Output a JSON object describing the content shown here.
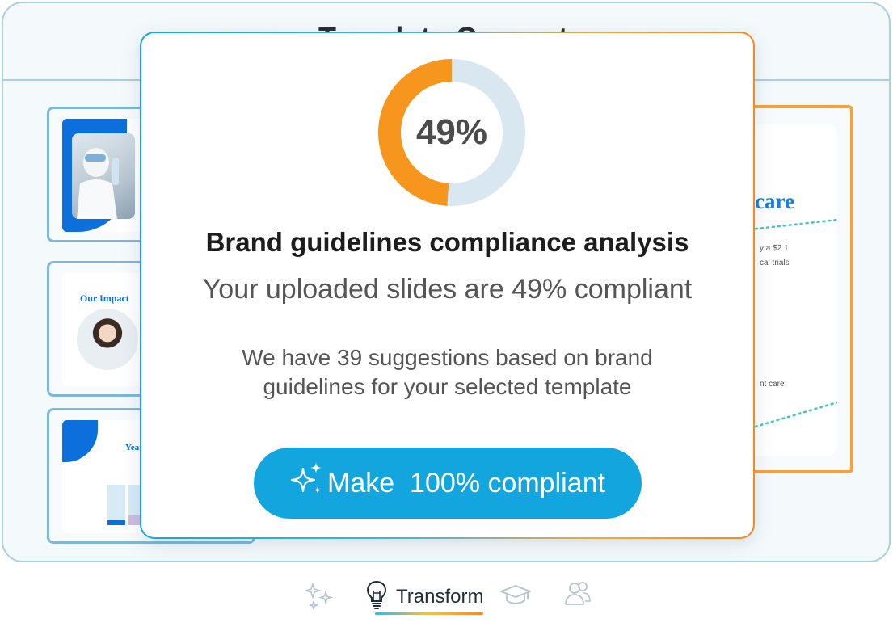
{
  "window": {
    "title": "Template Converter"
  },
  "thumbnails": [
    {
      "heading": ""
    },
    {
      "heading": "Our Impact"
    },
    {
      "heading": "Year"
    }
  ],
  "right_slide": {
    "heading": "care",
    "text_1": "y a $2.1",
    "text_2": "cal trials",
    "text_3": "nt care"
  },
  "modal": {
    "score_percent": 49,
    "score_label": "49%",
    "title": "Brand guidelines compliance analysis",
    "subtitle": "Your uploaded slides are 49% compliant",
    "description": "We have 39 suggestions based on brand guidelines for your selected template",
    "cta_label": "Make  100% compliant"
  },
  "colors": {
    "accent": "#13a5de",
    "donut_fill": "#f7961d",
    "donut_track": "#d8e7f0",
    "frame_border": "#a9cfe0",
    "right_slide_border": "#f6a23a"
  },
  "bottom_nav": {
    "items": [
      {
        "icon": "sparkles-icon",
        "label": ""
      },
      {
        "icon": "lightbulb-icon",
        "label": "Transform"
      },
      {
        "icon": "graduation-cap-icon",
        "label": ""
      },
      {
        "icon": "users-icon",
        "label": ""
      }
    ]
  }
}
